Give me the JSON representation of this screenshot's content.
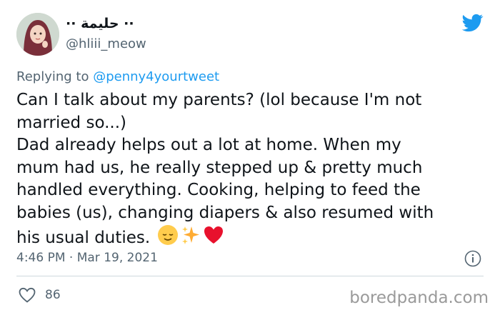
{
  "user": {
    "display_name": "·· حليمة ··",
    "handle": "@hliii_meow"
  },
  "reply": {
    "prefix": "Replying to ",
    "mention": "@penny4yourtweet"
  },
  "tweet": {
    "lines": [
      "Can I talk about my parents? (lol because I'm not",
      "married so...)",
      "Dad already helps out a lot at home. When my",
      "mum had us, he really stepped up & pretty much",
      "handled everything. Cooking, helping to feed the",
      "babies (us), changing diapers & also resumed with",
      "his usual duties."
    ],
    "emojis": [
      "relieved-face",
      "sparkles",
      "red-heart"
    ]
  },
  "timestamp": "4:46 PM · Mar 19, 2021",
  "likes": "86",
  "watermark": "boredpanda.com",
  "colors": {
    "twitter_blue": "#1d9bf0",
    "text": "#0f1419",
    "secondary": "#536471",
    "heart": "#e8112d"
  },
  "icons": [
    "twitter-bird-icon",
    "info-icon",
    "heart-outline-icon"
  ]
}
